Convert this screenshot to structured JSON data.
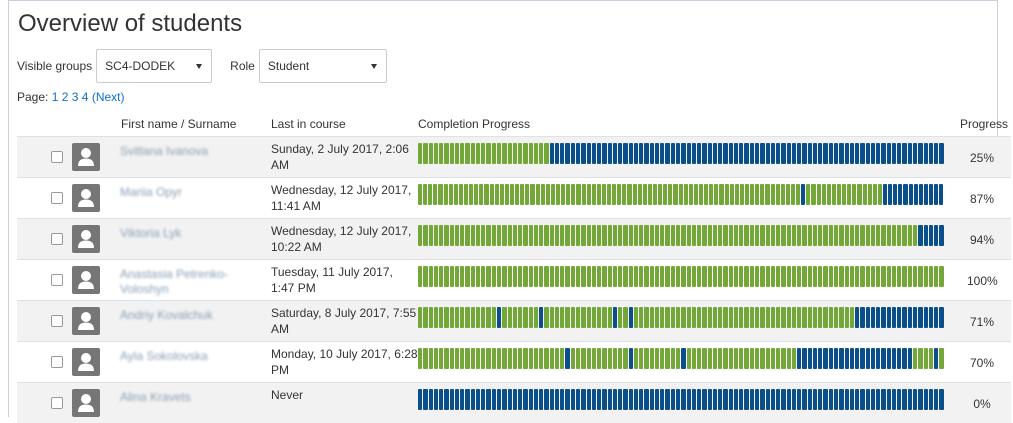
{
  "title": "Overview of students",
  "filters": {
    "groups_label": "Visible groups",
    "groups_value": "SC4-DODEK",
    "role_label": "Role",
    "role_value": "Student"
  },
  "pager": {
    "label": "Page:",
    "pages": [
      "1",
      "2",
      "3",
      "4"
    ],
    "next": "(Next)"
  },
  "columns": {
    "name": "First name / Surname",
    "last": "Last in course",
    "completion": "Completion Progress",
    "progress": "Progress"
  },
  "colors": {
    "complete": "#73a839",
    "incomplete": "#0a4f8a"
  },
  "students": [
    {
      "name": "Svitlana Ivanova",
      "last": "Sunday, 2 July 2017, 2:06 AM",
      "progress": "25%",
      "completion": "1111111111111111111111111000000000000000000000000000000000000000000000000000000000000000000000000000"
    },
    {
      "name": "Mariia Opyr",
      "last": "Wednesday, 12 July 2017, 11:41 AM",
      "progress": "87%",
      "completion": "1111111111111111111111111111111111111111111111111111111111111111111111111110111111111111111000000000000"
    },
    {
      "name": "Viktoria Lyk",
      "last": "Wednesday, 12 July 2017, 10:22 AM",
      "progress": "94%",
      "completion": "1111111111111111111111111111111111111111111111111111111111111111111111111111111111111111111111100000"
    },
    {
      "name": "Anastasia Petrenko-Voloshyn",
      "last": "Tuesday, 11 July 2017, 1:47 PM",
      "progress": "100%",
      "completion": "1111111111111111111111111111111111111111111111111111111111111111111111111111111111111111111111111111"
    },
    {
      "name": "Andriy Kovalchuk",
      "last": "Saturday, 8 July 2017, 7:55 AM",
      "progress": "71%",
      "completion": "1111111111111110111111101111111111111011011111111111111111111111111111111111111111100000000000000000"
    },
    {
      "name": "Ayla Sokolovska",
      "last": "Monday, 10 July 2017, 6:28 PM",
      "progress": "70%",
      "completion": "1111111111111111111111111111011111111111011111111101111111111111111111110000000000000000000000111101"
    },
    {
      "name": "Alina Kravets",
      "last": "Never",
      "progress": "0%",
      "completion": "0000000000000000000000000000000000000000000000000000000000000000000000000000000000000000000000000000"
    }
  ]
}
